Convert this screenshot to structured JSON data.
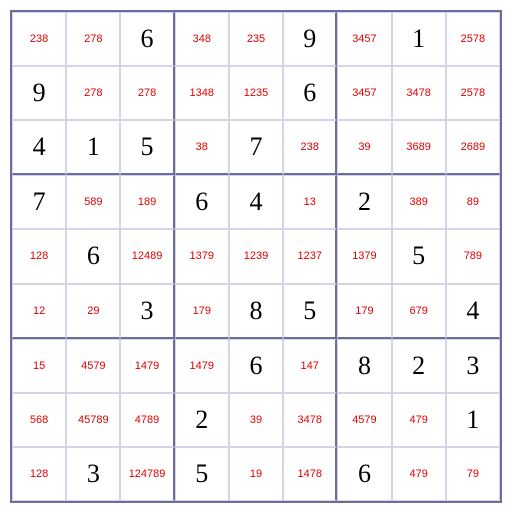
{
  "cells": [
    [
      "238",
      "278",
      "6",
      "348",
      "235",
      "9",
      "3457",
      "1",
      "2578",
      "9",
      "278",
      "278",
      "1348",
      "1235",
      "6",
      "3457",
      "3478",
      "2578",
      "4",
      "1",
      "5",
      "38",
      "7",
      "238",
      "39",
      "3689",
      "2689",
      "7",
      "589",
      "189",
      "6",
      "4",
      "13",
      "2",
      "389",
      "89",
      "128",
      "6",
      "12489",
      "1379",
      "1239",
      "1237",
      "1379",
      "5",
      "789",
      "12",
      "29",
      "3",
      "179",
      "8",
      "5",
      "179",
      "679",
      "4",
      "15",
      "4579",
      "1479",
      "1479",
      "6",
      "147",
      "8",
      "2",
      "3",
      "568",
      "45789",
      "4789",
      "2",
      "39",
      "3478",
      "4579",
      "479",
      "1",
      "128",
      "3",
      "124789",
      "5",
      "19",
      "1478",
      "6",
      "479",
      "79"
    ]
  ],
  "given": [
    false,
    false,
    true,
    false,
    false,
    true,
    false,
    true,
    false,
    true,
    false,
    false,
    false,
    false,
    true,
    false,
    false,
    false,
    true,
    true,
    true,
    false,
    true,
    false,
    false,
    false,
    false,
    true,
    false,
    false,
    true,
    true,
    false,
    true,
    false,
    false,
    false,
    true,
    false,
    false,
    false,
    false,
    false,
    true,
    false,
    false,
    false,
    true,
    false,
    true,
    true,
    false,
    false,
    true,
    false,
    false,
    false,
    false,
    true,
    false,
    true,
    true,
    true,
    false,
    false,
    false,
    true,
    false,
    false,
    false,
    false,
    true,
    false,
    true,
    false,
    true,
    false,
    false,
    true,
    false,
    false
  ]
}
